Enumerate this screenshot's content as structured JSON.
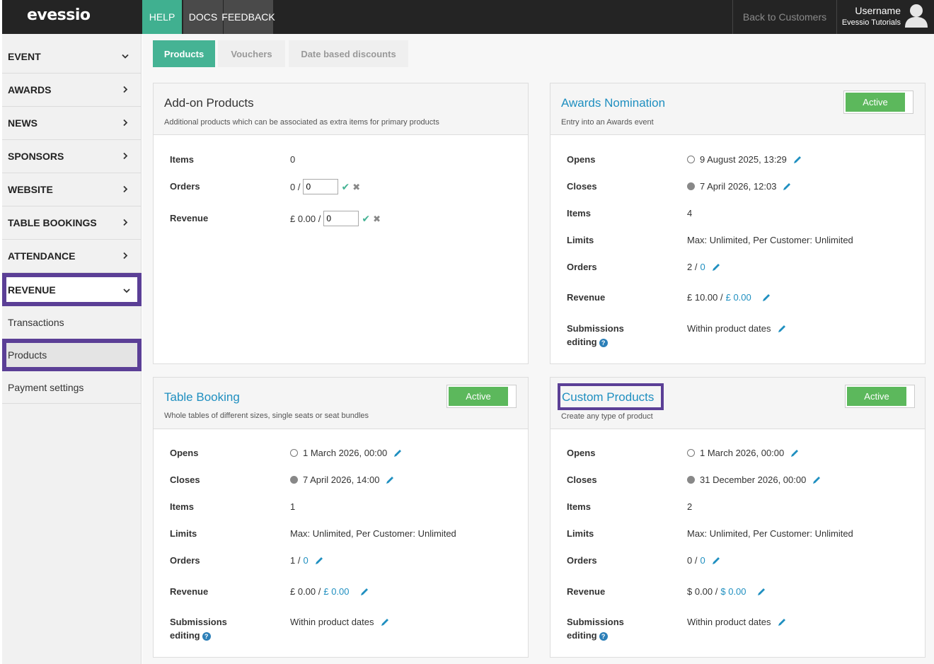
{
  "header": {
    "logo": "evessio",
    "nav": [
      "HELP",
      "DOCS",
      "FEEDBACK"
    ],
    "back_link": "Back to Customers",
    "user": {
      "name": "Username",
      "org": "Evessio Tutorials"
    }
  },
  "sidebar": {
    "items": [
      {
        "label": "EVENT",
        "icon": "chevron-down-icon",
        "chev": "⌄"
      },
      {
        "label": "AWARDS",
        "icon": "chevron-right-icon",
        "chev": "›"
      },
      {
        "label": "NEWS",
        "icon": "chevron-right-icon",
        "chev": "›"
      },
      {
        "label": "SPONSORS",
        "icon": "chevron-right-icon",
        "chev": "›"
      },
      {
        "label": "WEBSITE",
        "icon": "chevron-right-icon",
        "chev": "›"
      },
      {
        "label": "TABLE BOOKINGS",
        "icon": "chevron-right-icon",
        "chev": "›"
      },
      {
        "label": "ATTENDANCE",
        "icon": "chevron-right-icon",
        "chev": "›"
      },
      {
        "label": "REVENUE",
        "icon": "chevron-down-icon",
        "chev": "⌄"
      }
    ],
    "sub_items": [
      "Transactions",
      "Products",
      "Payment settings"
    ],
    "highlight_color": "#5b3f96"
  },
  "tabs": [
    "Products",
    "Vouchers",
    "Date based discounts"
  ],
  "cards": {
    "addon": {
      "title": "Add-on Products",
      "subtitle": "Additional products which can be associated as extra items for primary products",
      "items_label": "Items",
      "items_value": "0",
      "orders_label": "Orders",
      "orders_prefix": "0 /",
      "orders_input": "0",
      "revenue_label": "Revenue",
      "revenue_prefix": "£ 0.00 /",
      "revenue_input": "0"
    },
    "awards": {
      "title": "Awards Nomination",
      "subtitle": "Entry into an Awards event",
      "status": "Active",
      "opens_label": "Opens",
      "opens": "9 August 2025, 13:29",
      "closes_label": "Closes",
      "closes": "7 April 2026, 12:03",
      "items_label": "Items",
      "items": "4",
      "limits_label": "Limits",
      "limits": "Max: Unlimited, Per Customer: Unlimited",
      "orders_label": "Orders",
      "orders_a": "2 /",
      "orders_b": "0",
      "revenue_label": "Revenue",
      "revenue_a": "£ 10.00 /",
      "revenue_b": "£ 0.00",
      "sub_label_1": "Submissions",
      "sub_label_2": "editing",
      "submissions": "Within product dates"
    },
    "table": {
      "title": "Table Booking",
      "subtitle": "Whole tables of different sizes, single seats or seat bundles",
      "status": "Active",
      "opens_label": "Opens",
      "opens": "1 March 2026, 00:00",
      "closes_label": "Closes",
      "closes": "7 April 2026, 14:00",
      "items_label": "Items",
      "items": "1",
      "limits_label": "Limits",
      "limits": "Max: Unlimited, Per Customer: Unlimited",
      "orders_label": "Orders",
      "orders_a": "1 /",
      "orders_b": "0",
      "revenue_label": "Revenue",
      "revenue_a": "£ 0.00 /",
      "revenue_b": "£ 0.00",
      "sub_label_1": "Submissions",
      "sub_label_2": "editing",
      "submissions": "Within product dates"
    },
    "custom": {
      "title": "Custom Products",
      "subtitle": "Create any type of product",
      "status": "Active",
      "opens_label": "Opens",
      "opens": "1 March 2026, 00:00",
      "closes_label": "Closes",
      "closes": "31 December 2026, 00:00",
      "items_label": "Items",
      "items": "2",
      "limits_label": "Limits",
      "limits": "Max: Unlimited, Per Customer: Unlimited",
      "orders_label": "Orders",
      "orders_a": "0 /",
      "orders_b": "0",
      "revenue_label": "Revenue",
      "revenue_a": "$ 0.00 /",
      "revenue_b": "$ 0.00",
      "sub_label_1": "Submissions",
      "sub_label_2": "editing",
      "submissions": "Within product dates"
    }
  },
  "colors": {
    "accent": "#45b394",
    "link": "#1f8fc0",
    "active": "#5cb85c",
    "topbar": "#242424"
  }
}
